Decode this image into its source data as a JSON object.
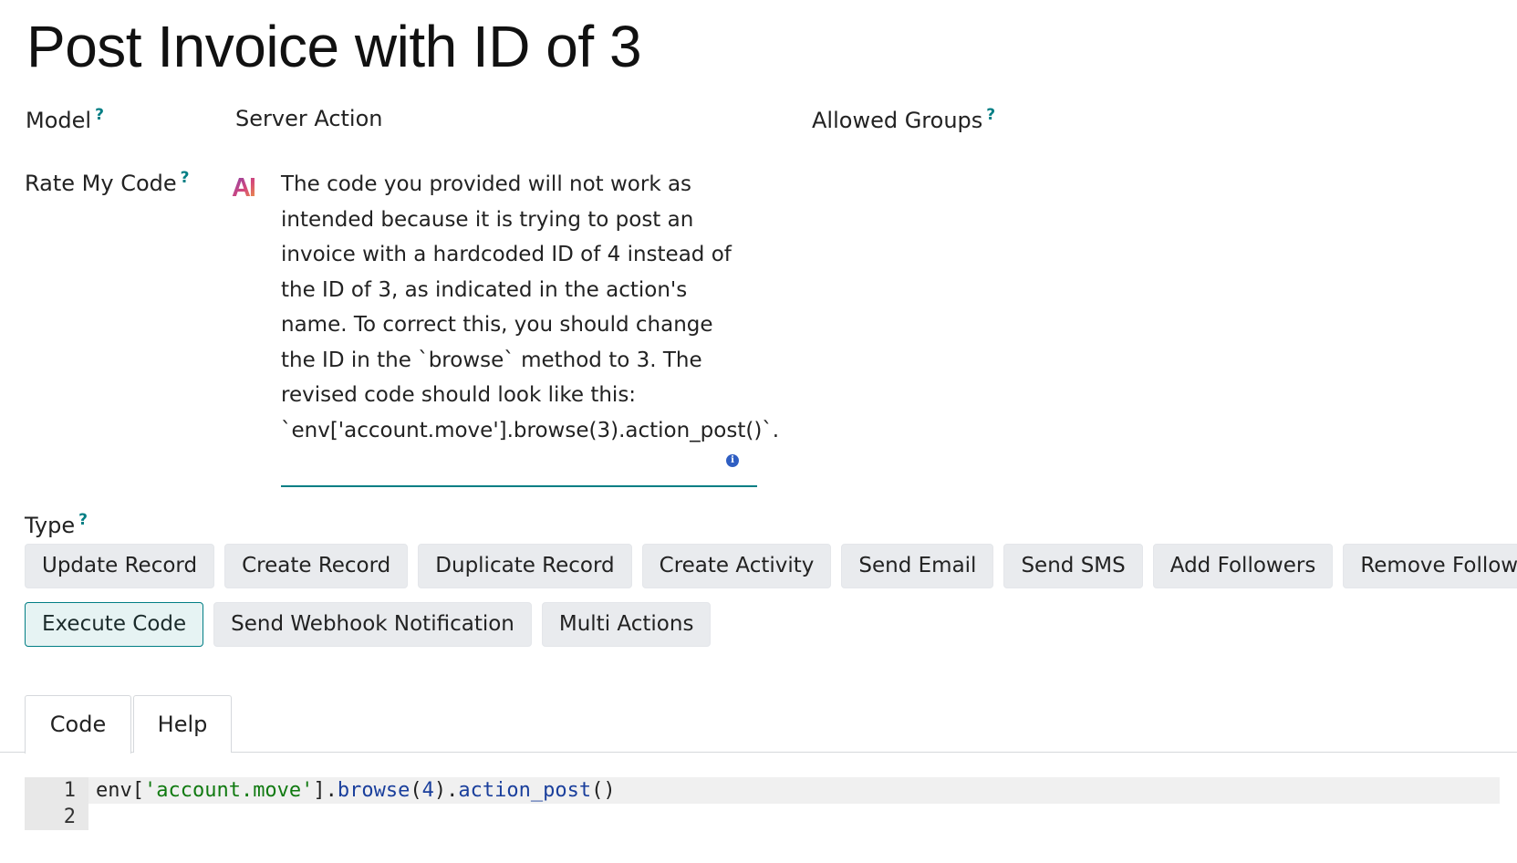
{
  "page": {
    "title": "Post Invoice with ID of 3"
  },
  "fields": {
    "model": {
      "label": "Model",
      "help": "?"
    },
    "server_action": {
      "label": "Server Action"
    },
    "allowed_groups": {
      "label": "Allowed Groups",
      "help": "?"
    },
    "rate_my_code": {
      "label": "Rate My Code",
      "help": "?",
      "ai_badge": "AI",
      "feedback": "The code you provided will not work as intended because it is trying to post an invoice with a hardcoded ID of 4 instead of the ID of 3, as indicated in the action's name. To correct this, you should change the ID in the `browse` method to 3. The revised code should look like this: `env['account.move'].browse(3).action_post()`.",
      "info_icon": "info-icon"
    },
    "type": {
      "label": "Type",
      "help": "?",
      "options_row1": [
        "Update Record",
        "Create Record",
        "Duplicate Record",
        "Create Activity",
        "Send Email",
        "Send SMS",
        "Add Followers",
        "Remove Followers"
      ],
      "options_row2": [
        "Execute Code",
        "Send Webhook Notification",
        "Multi Actions"
      ],
      "selected": "Execute Code"
    }
  },
  "tabs": [
    {
      "label": "Code",
      "active": true
    },
    {
      "label": "Help",
      "active": false
    }
  ],
  "editor": {
    "lines": [
      {
        "number": "1",
        "tokens": [
          {
            "t": "env[",
            "c": "plain"
          },
          {
            "t": "'account.move'",
            "c": "str"
          },
          {
            "t": "].",
            "c": "plain"
          },
          {
            "t": "browse",
            "c": "fn"
          },
          {
            "t": "(",
            "c": "plain"
          },
          {
            "t": "4",
            "c": "num"
          },
          {
            "t": ").",
            "c": "plain"
          },
          {
            "t": "action_post",
            "c": "fn"
          },
          {
            "t": "()",
            "c": "plain"
          }
        ]
      },
      {
        "number": "2",
        "tokens": []
      }
    ]
  },
  "colors": {
    "accent": "#017e84",
    "button_bg": "#e9ebee",
    "info_blue": "#2f5ec2"
  }
}
